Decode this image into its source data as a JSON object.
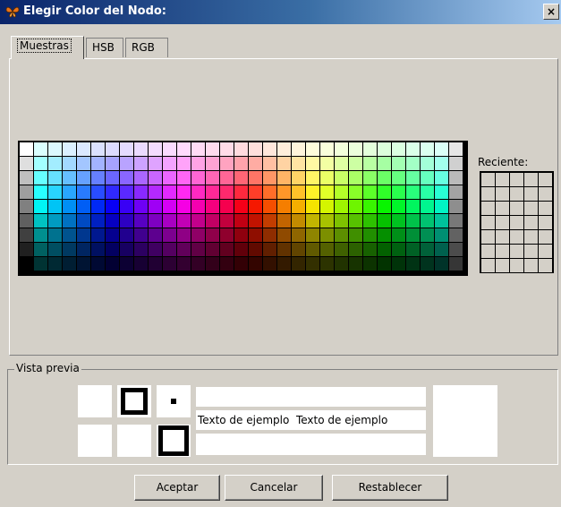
{
  "window": {
    "title": "Elegir Color del Nodo:",
    "close_glyph": "×",
    "app_icon": "butterfly-icon"
  },
  "tabs": [
    {
      "label": "Muestras",
      "active": true
    },
    {
      "label": "HSB",
      "active": false
    },
    {
      "label": "RGB",
      "active": false
    }
  ],
  "swatches": {
    "columns": 31,
    "rows": 9
  },
  "recent": {
    "label": "Reciente:",
    "columns": 5,
    "rows": 7,
    "color": "#d4d0c8"
  },
  "preview": {
    "legend": "Vista previa",
    "sample_text": "Texto de ejemplo",
    "row1_color": "#ffffff",
    "row2_color": "#000000"
  },
  "buttons": {
    "ok": "Aceptar",
    "cancel": "Cancelar",
    "reset": "Restablecer"
  }
}
